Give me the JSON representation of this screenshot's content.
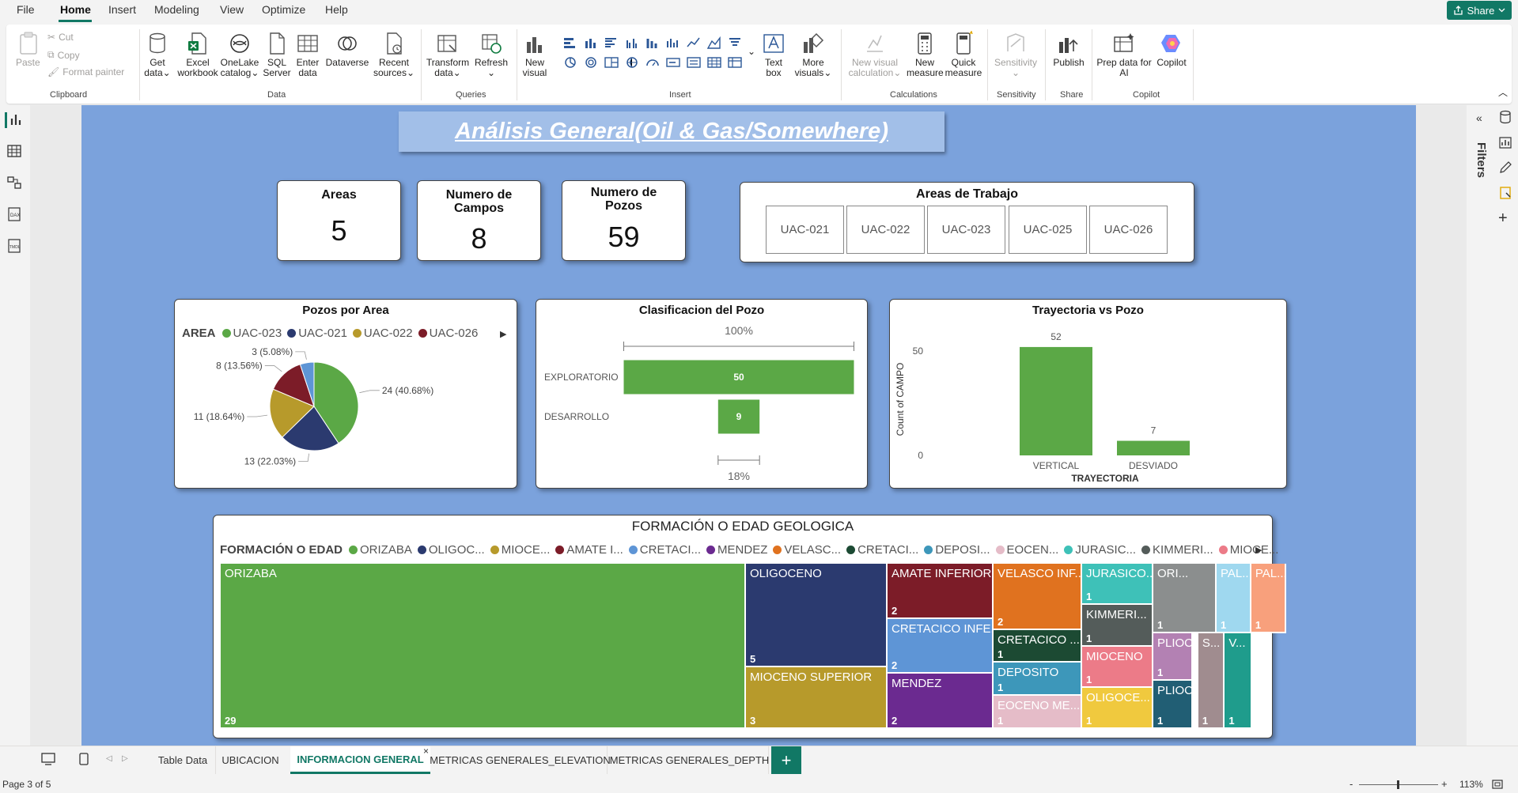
{
  "menu": {
    "items": [
      "File",
      "Home",
      "Insert",
      "Modeling",
      "View",
      "Optimize",
      "Help"
    ],
    "share_label": "Share"
  },
  "ribbon": {
    "clipboard": {
      "paste": "Paste",
      "cut": "Cut",
      "copy": "Copy",
      "format_painter": "Format painter",
      "group": "Clipboard"
    },
    "data": {
      "get_data": [
        "Get",
        "data"
      ],
      "excel": [
        "Excel",
        "workbook"
      ],
      "onelake": [
        "OneLake",
        "catalog"
      ],
      "sql": [
        "SQL",
        "Server"
      ],
      "enter": [
        "Enter",
        "data"
      ],
      "dataverse": "Dataverse",
      "recent": [
        "Recent",
        "sources"
      ],
      "group": "Data"
    },
    "queries": {
      "transform": [
        "Transform",
        "data"
      ],
      "refresh": "Refresh",
      "group": "Queries"
    },
    "insert": {
      "new_visual": [
        "New",
        "visual"
      ],
      "text_box": [
        "Text",
        "box"
      ],
      "more_visuals": [
        "More",
        "visuals"
      ],
      "group": "Insert"
    },
    "calculations": {
      "new_visual_calc": [
        "New visual",
        "calculation"
      ],
      "new_measure": [
        "New",
        "measure"
      ],
      "quick_measure": [
        "Quick",
        "measure"
      ],
      "group": "Calculations"
    },
    "sensitivity": {
      "label": "Sensitivity",
      "group": "Sensitivity"
    },
    "share": {
      "publish": "Publish",
      "group": "Share"
    },
    "copilot": {
      "prep": [
        "Prep data for",
        "AI"
      ],
      "copilot": "Copilot",
      "group": "Copilot"
    }
  },
  "right_pane": {
    "filters_label": "Filters"
  },
  "report": {
    "title": "Análisis General(Oil & Gas/Somewhere)",
    "cards": [
      {
        "title": [
          "Areas"
        ],
        "value": "5"
      },
      {
        "title": [
          "Numero de",
          "Campos"
        ],
        "value": "8"
      },
      {
        "title": [
          "Numero de",
          "Pozos"
        ],
        "value": "59"
      }
    ],
    "areas_trabajo": {
      "title": "Areas de Trabajo",
      "items": [
        "UAC-021",
        "UAC-022",
        "UAC-023",
        "UAC-025",
        "UAC-026"
      ]
    }
  },
  "chart_data": [
    {
      "type": "pie",
      "title": "Pozos por Area",
      "legend_title": "AREA",
      "legend_position": "top-left",
      "categories": [
        "UAC-023",
        "UAC-021",
        "UAC-022",
        "UAC-026",
        "UAC-025"
      ],
      "legend_visible": [
        "UAC-023",
        "UAC-021",
        "UAC-022",
        "UAC-026"
      ],
      "values": [
        24,
        13,
        11,
        8,
        3
      ],
      "labels": [
        "24 (40.68%)",
        "13 (22.03%)",
        "11 (18.64%)",
        "8 (13.56%)",
        "3 (5.08%)"
      ],
      "colors": [
        "#5ba846",
        "#2b3a6f",
        "#b79a2b",
        "#7c1c28",
        "#5e95d6"
      ]
    },
    {
      "type": "bar",
      "subtype": "funnel",
      "title": "Clasificacion del Pozo",
      "categories": [
        "EXPLORATORIO",
        "DESARROLLO"
      ],
      "values": [
        50,
        9
      ],
      "top_label": "100%",
      "bottom_label": "18%",
      "color": "#5ba846"
    },
    {
      "type": "bar",
      "title": "Trayectoria vs Pozo",
      "categories": [
        "VERTICAL",
        "DESVIADO"
      ],
      "values": [
        52,
        7
      ],
      "xlabel": "TRAYECTORIA",
      "ylabel": "Count of CAMPO",
      "yticks": [
        0,
        50
      ],
      "ylim": [
        0,
        55
      ],
      "color": "#5ba846"
    },
    {
      "type": "treemap",
      "title": "FORMACIÓN O EDAD GEOLOGICA",
      "legend_title": "FORMACIÓN O EDAD",
      "legend": [
        {
          "label": "ORIZABA",
          "color": "#5ba846"
        },
        {
          "label": "OLIGOC...",
          "color": "#2b3a6f"
        },
        {
          "label": "MIOCE...",
          "color": "#b79a2b"
        },
        {
          "label": "AMATE I...",
          "color": "#7c1c28"
        },
        {
          "label": "CRETACI...",
          "color": "#5e95d6"
        },
        {
          "label": "MENDEZ",
          "color": "#6b2a90"
        },
        {
          "label": "VELASC...",
          "color": "#e0721f"
        },
        {
          "label": "CRETACI...",
          "color": "#1c4a33"
        },
        {
          "label": "DEPOSI...",
          "color": "#3d97ba"
        },
        {
          "label": "EOCEN...",
          "color": "#e5bcc8"
        },
        {
          "label": "JURASIC...",
          "color": "#3ec1b8"
        },
        {
          "label": "KIMMERI...",
          "color": "#545c5a"
        },
        {
          "label": "MIOCE...",
          "color": "#ec7b88"
        }
      ],
      "nodes": [
        {
          "label": "ORIZABA",
          "value": 29,
          "color": "#5ba846"
        },
        {
          "label": "OLIGOCENO",
          "value": 5,
          "color": "#2b3a6f"
        },
        {
          "label": "MIOCENO SUPERIOR",
          "value": 3,
          "color": "#b79a2b"
        },
        {
          "label": "AMATE INFERIOR",
          "value": 2,
          "color": "#7c1c28"
        },
        {
          "label": "CRETACICO INFE...",
          "value": 2,
          "color": "#5e95d6"
        },
        {
          "label": "MENDEZ",
          "value": 2,
          "color": "#6b2a90"
        },
        {
          "label": "VELASCO INF...",
          "value": 2,
          "color": "#e0721f"
        },
        {
          "label": "CRETACICO ...",
          "value": 1,
          "color": "#1c4a33"
        },
        {
          "label": "DEPOSITO",
          "value": 1,
          "color": "#3d97ba"
        },
        {
          "label": "EOCENO ME...",
          "value": 1,
          "color": "#e5bcc8"
        },
        {
          "label": "JURASICO...",
          "value": 1,
          "color": "#3ec1b8"
        },
        {
          "label": "KIMMERI...",
          "value": 1,
          "color": "#545c5a"
        },
        {
          "label": "MIOCENO",
          "value": 1,
          "color": "#ec7b88"
        },
        {
          "label": "OLIGOCE...",
          "value": 1,
          "color": "#f0c93e"
        },
        {
          "label": "ORI...",
          "value": 1,
          "color": "#8b8e8e"
        },
        {
          "label": "PLIOCE...",
          "value": 1,
          "color": "#b381b3"
        },
        {
          "label": "PLIOCE...",
          "value": 1,
          "color": "#215e74"
        },
        {
          "label": "PAL...",
          "value": 1,
          "color": "#9fd8ef"
        },
        {
          "label": "PAL...",
          "value": 1,
          "color": "#f8a07c"
        },
        {
          "label": "S...",
          "value": 1,
          "color": "#a08c8f"
        },
        {
          "label": "V...",
          "value": 1,
          "color": "#1f9c8c"
        }
      ]
    }
  ],
  "tabs": {
    "items": [
      "Table Data",
      "UBICACION",
      "INFORMACION GENERAL",
      "METRICAS GENERALES_ELEVATION",
      "METRICAS GENERALES_DEPTH"
    ],
    "active": "INFORMACION GENERAL",
    "add_label": "+"
  },
  "status": {
    "page": "Page 3 of 5",
    "zoom": "113%",
    "zoom_minus": "-",
    "zoom_plus": "+"
  }
}
